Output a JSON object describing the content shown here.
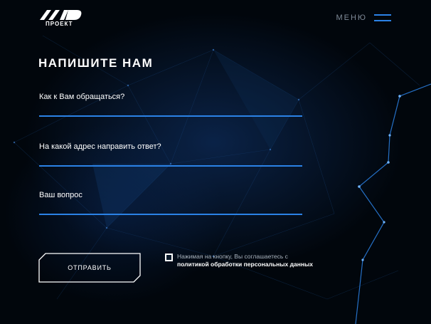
{
  "header": {
    "logo_text": "АМД",
    "logo_subtitle": "ПРОЕКТ",
    "menu_label": "МЕНЮ",
    "menu_icon": "hamburger-icon"
  },
  "form": {
    "title": "НАПИШИТЕ НАМ",
    "fields": [
      {
        "label": "Как к Вам обращаться?",
        "value": ""
      },
      {
        "label": "На какой адрес направить ответ?",
        "value": ""
      },
      {
        "label": "Ваш вопрос",
        "value": ""
      }
    ],
    "submit_label": "ОТПРАВИТЬ",
    "consent": {
      "checked": true,
      "text_before": "Нажимая на кнопку, Вы соглашаетесь с ",
      "link_text": "политикой обработки персональных данных"
    }
  },
  "colors": {
    "background": "#01060c",
    "accent": "#2b82e6",
    "text": "#ffffff",
    "muted_text": "#a8b2bd"
  }
}
